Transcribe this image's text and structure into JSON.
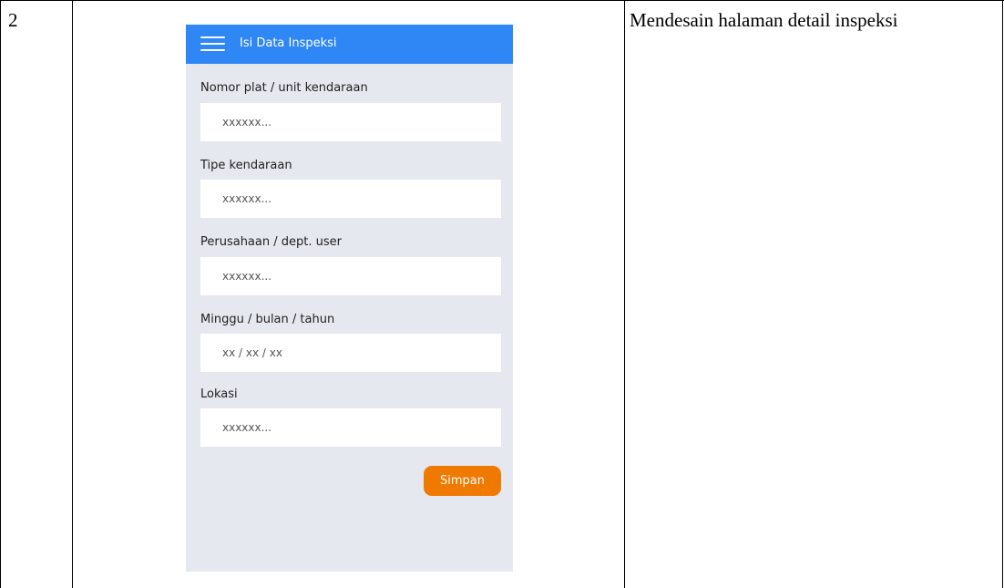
{
  "document": {
    "row_number": "2",
    "description": "Mendesain halaman detail inspeksi"
  },
  "app": {
    "title": "Isi Data Inspeksi",
    "menu_icon": "hamburger-menu-icon",
    "colors": {
      "appbar": "#2f86f5",
      "background": "#e6e8ef",
      "button": "#f07a00"
    }
  },
  "form": {
    "fields": [
      {
        "label": "Nomor plat / unit kendaraan",
        "placeholder": "xxxxxx..."
      },
      {
        "label": "Tipe kendaraan",
        "placeholder": "xxxxxx..."
      },
      {
        "label": "Perusahaan / dept. user",
        "placeholder": "xxxxxx..."
      },
      {
        "label": "Minggu / bulan / tahun",
        "placeholder": "xx / xx / xx"
      },
      {
        "label": "Lokasi",
        "placeholder": "xxxxxx..."
      }
    ],
    "save_label": "Simpan"
  }
}
